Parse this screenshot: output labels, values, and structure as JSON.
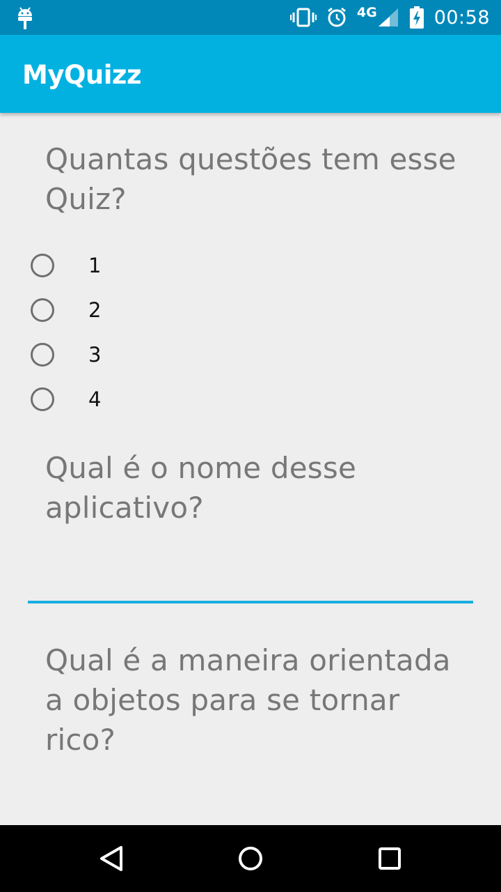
{
  "status_bar": {
    "time": "00:58",
    "network": "4G",
    "icons": [
      "android-debug-icon",
      "vibrate-icon",
      "alarm-icon",
      "signal-icon",
      "battery-charging-icon"
    ]
  },
  "app_bar": {
    "title": "MyQuizz",
    "color": "#03b1e1"
  },
  "questions": [
    {
      "text": "Quantas questões tem esse Quiz?",
      "type": "radio",
      "options": [
        "1",
        "2",
        "3",
        "4"
      ]
    },
    {
      "text": "Qual é o nome desse aplicativo?",
      "type": "text",
      "value": "",
      "placeholder": ""
    },
    {
      "text": "Qual é a maneira orientada a objetos para se tornar rico?",
      "type": "text"
    }
  ],
  "nav_bar": {
    "icons": [
      "back-icon",
      "home-icon",
      "recents-icon"
    ]
  }
}
